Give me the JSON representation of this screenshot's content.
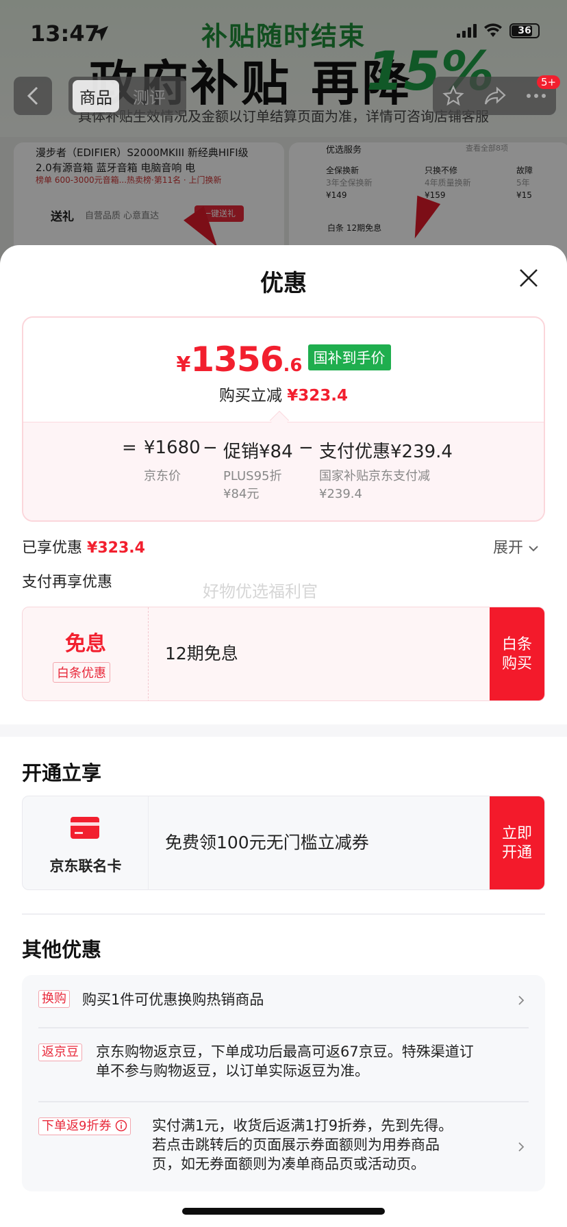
{
  "status_bar": {
    "time": "13:47",
    "battery": "36"
  },
  "background": {
    "banner_top": "补贴随时结束",
    "banner_main": "政府补贴 再降",
    "banner_pct": "15%",
    "banner_note": "具体补贴生效情况及金额以订单结算页面为准，详情可咨询店铺客服",
    "nav_tabs": [
      "商品",
      "测评"
    ],
    "cart_badge": "5+",
    "product_title": "漫步者（EDIFIER）S2000MKIII 新经典HIFI级2.0有源音箱 蓝牙音箱 电脑音响 电",
    "product_tags": "榜单 600-3000元音箱...热卖榜·第11名 · 上门换新",
    "gift_label": "送礼",
    "gift_sub": "自营品质 心意直达",
    "gift_button": "一键送礼",
    "service_title": "优选服务",
    "service_all": "查看全部8项",
    "services": [
      {
        "name": "全保换新",
        "desc": "3年全保换新",
        "price": "¥149"
      },
      {
        "name": "只换不修",
        "desc": "4年质量换新",
        "price": "¥159"
      },
      {
        "name": "故障",
        "desc": "5年",
        "price": "¥15"
      }
    ],
    "baitiao_line": "白条 12期免息"
  },
  "sheet": {
    "title": "优惠",
    "price": {
      "symbol": "¥",
      "integer": "1356",
      "decimal": ".6",
      "tag": "国补到手价"
    },
    "reduce": {
      "label": "购买立减",
      "amount": "¥323.4"
    },
    "breakdown": {
      "eq": "=",
      "jd_price": "¥1680",
      "jd_price_label": "京东价",
      "minus1": "−",
      "promo": "促销¥84",
      "promo_sub1": "PLUS95折",
      "promo_sub2": "¥84元",
      "minus2": "−",
      "pay": "支付优惠¥239.4",
      "pay_sub1": "国家补贴京东支付减",
      "pay_sub2": "¥239.4"
    },
    "enjoyed": {
      "label": "已享优惠",
      "amount": "¥323.4"
    },
    "expand": "展开",
    "pay_more_title": "支付再享优惠",
    "watermark": "好物优选福利官",
    "baitiao_card": {
      "big": "免息",
      "small": "白条优惠",
      "text": "12期免息",
      "button_line1": "白条",
      "button_line2": "购买"
    },
    "open_title": "开通立享",
    "jd_card": {
      "name": "京东联名卡",
      "text": "免费领100元无门槛立减券",
      "button_line1": "立即",
      "button_line2": "开通"
    },
    "other_title": "其他优惠",
    "other_items": [
      {
        "tag": "换购",
        "text": "购买1件可优惠换购热销商品"
      },
      {
        "tag": "返京豆",
        "line1": "京东购物返京豆，下单成功后最高可返67京豆。特殊渠道订",
        "line2": "单不参与购物返豆，以订单实际返豆为准。"
      },
      {
        "tag": "下单返9折券",
        "line1": "实付满1元，收货后返满1打9折券，先到先得。",
        "line2": "若点击跳转后的页面展示券面额则为用券商品",
        "line3": "页，如无券面额则为凑单商品页或活动页。"
      }
    ]
  },
  "colors": {
    "accent_red": "#f21f2e",
    "green_tag": "#1fae4e"
  }
}
